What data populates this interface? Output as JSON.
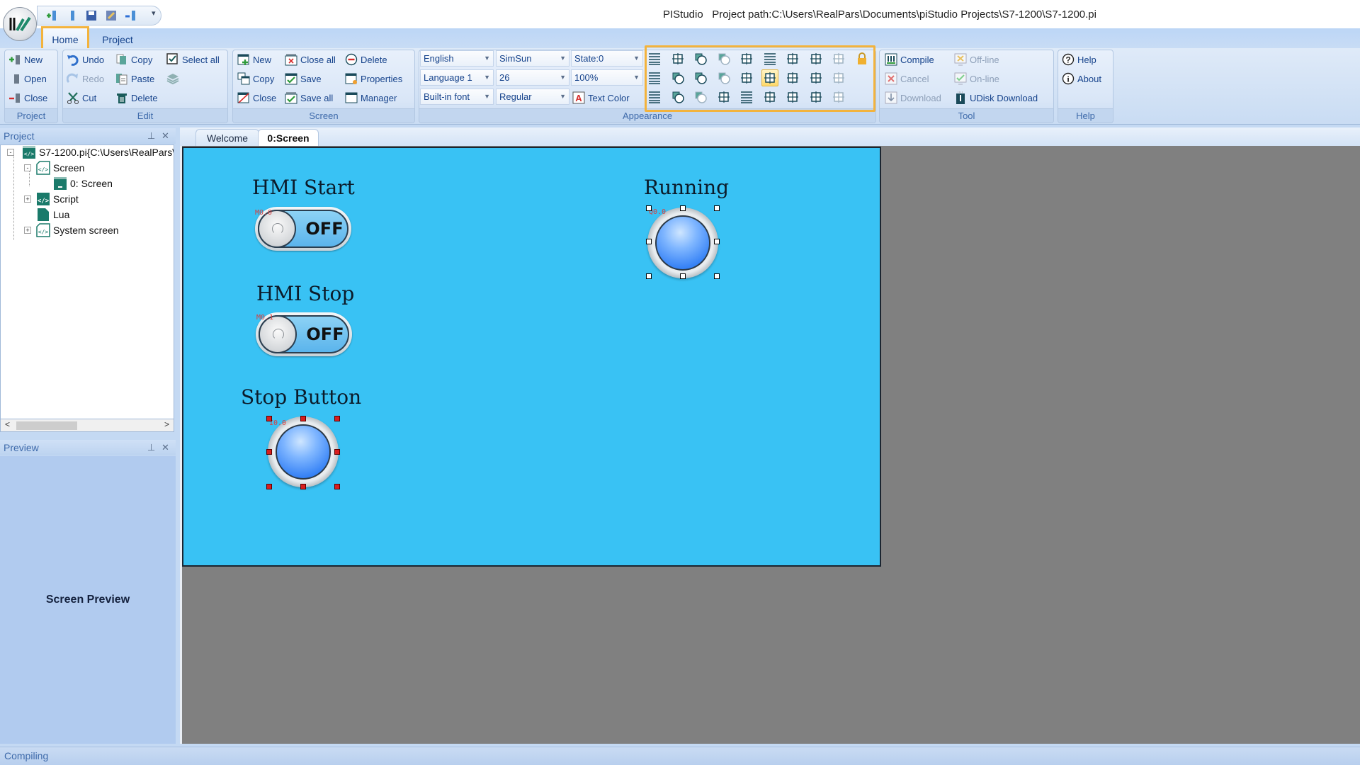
{
  "window": {
    "title": "PIStudio   Project path:C:\\Users\\RealPars\\Documents\\piStudio Projects\\S7-1200\\S7-1200.pi",
    "quick_access": [
      "new-project-icon",
      "open-icon",
      "save-icon",
      "edit-icon",
      "download-icon"
    ],
    "qat_dropdown": "▾"
  },
  "ribbon_tabs": [
    {
      "label": "Home",
      "active": true
    },
    {
      "label": "Project",
      "active": false
    }
  ],
  "ribbon": {
    "project": {
      "label": "Project",
      "buttons": [
        {
          "label": "New",
          "icon": "new-project-icon",
          "enabled": true
        },
        {
          "label": "Open",
          "icon": "open-icon",
          "enabled": true
        },
        {
          "label": "Close",
          "icon": "close-project-icon",
          "enabled": true
        }
      ]
    },
    "edit": {
      "label": "Edit",
      "buttons": [
        {
          "label": "Undo",
          "icon": "undo-icon",
          "enabled": true
        },
        {
          "label": "Redo",
          "icon": "redo-icon",
          "enabled": false
        },
        {
          "label": "Cut",
          "icon": "cut-icon",
          "enabled": true
        },
        {
          "label": "Copy",
          "icon": "copy-icon",
          "enabled": true
        },
        {
          "label": "Paste",
          "icon": "paste-icon",
          "enabled": true
        },
        {
          "label": "Delete",
          "icon": "delete-icon",
          "enabled": true
        },
        {
          "label": "Select all",
          "icon": "select-all-icon",
          "enabled": true
        },
        {
          "label": "",
          "icon": "layers-icon",
          "enabled": false
        }
      ]
    },
    "screen": {
      "label": "Screen",
      "buttons": [
        {
          "label": "New",
          "icon": "new-screen-icon",
          "enabled": true
        },
        {
          "label": "Copy",
          "icon": "copy-screen-icon",
          "enabled": true
        },
        {
          "label": "Close",
          "icon": "close-screen-icon",
          "enabled": true
        },
        {
          "label": "Close all",
          "icon": "close-all-icon",
          "enabled": true
        },
        {
          "label": "Save",
          "icon": "save-screen-icon",
          "enabled": true
        },
        {
          "label": "Save all",
          "icon": "save-all-icon",
          "enabled": true
        },
        {
          "label": "Delete",
          "icon": "delete-screen-icon",
          "enabled": true
        },
        {
          "label": "Properties",
          "icon": "properties-icon",
          "enabled": true
        },
        {
          "label": "Manager",
          "icon": "manager-icon",
          "enabled": true
        }
      ]
    },
    "appearance": {
      "label": "Appearance",
      "combos": {
        "language": "English",
        "language_index": "Language 1",
        "font_source": "Built-in font",
        "font_name": "SimSun",
        "font_size": "26",
        "font_style": "Regular",
        "state": "State:0",
        "zoom": "100%"
      },
      "text_color_label": "Text Color",
      "tools": [
        [
          "align-left-icon",
          "bring-forward-icon",
          "bring-to-front-icon",
          "rotate-left-icon",
          "align-bottom-icon",
          "align-left-edge-icon",
          "move-left-icon",
          "same-width-icon",
          "space-horizontal-icon",
          "lock-icon"
        ],
        [
          "align-center-icon",
          "send-backward-icon",
          "group-icon",
          "rotate-right-icon",
          "center-vertical-icon",
          "center-horizontal-icon",
          "move-down-icon",
          "same-height-icon",
          "space-vertical-icon"
        ],
        [
          "align-right-icon",
          "send-to-back-icon",
          "ungroup-icon",
          "align-top-icon",
          "align-right-edge-icon",
          "move-up-icon",
          "move-right-icon",
          "same-size-icon",
          "format-painter-icon"
        ]
      ],
      "active_tool": "center-horizontal-icon"
    },
    "tool": {
      "label": "Tool",
      "buttons": [
        {
          "label": "Compile",
          "icon": "compile-icon",
          "enabled": true
        },
        {
          "label": "Cancel",
          "icon": "cancel-icon",
          "enabled": false
        },
        {
          "label": "Download",
          "icon": "download-icon",
          "enabled": false
        },
        {
          "label": "Off-line",
          "icon": "offline-icon",
          "enabled": false
        },
        {
          "label": "On-line",
          "icon": "online-icon",
          "enabled": false
        },
        {
          "label": "UDisk Download",
          "icon": "udisk-download-icon",
          "enabled": true
        }
      ]
    },
    "help": {
      "label": "Help",
      "buttons": [
        {
          "label": "Help",
          "icon": "help-icon",
          "enabled": true
        },
        {
          "label": "About",
          "icon": "about-icon",
          "enabled": true
        }
      ]
    }
  },
  "project_panel": {
    "title": "Project",
    "tree": [
      {
        "label": "S7-1200.pi{C:\\Users\\RealPars\\",
        "level": 0,
        "expander": "-",
        "icon": "project-file-icon"
      },
      {
        "label": "Screen",
        "level": 1,
        "expander": "-",
        "icon": "screen-folder-icon"
      },
      {
        "label": "0: Screen",
        "level": 2,
        "expander": "",
        "icon": "screen-page-icon"
      },
      {
        "label": "Script",
        "level": 1,
        "expander": "+",
        "icon": "script-icon"
      },
      {
        "label": "Lua",
        "level": 1,
        "expander": "",
        "icon": "lua-icon"
      },
      {
        "label": "System screen",
        "level": 1,
        "expander": "+",
        "icon": "system-screen-icon"
      }
    ]
  },
  "preview_panel": {
    "title": "Preview",
    "content": "Screen Preview"
  },
  "doc_tabs": [
    {
      "label": "Welcome",
      "active": false
    },
    {
      "label": "0:Screen",
      "active": true
    }
  ],
  "canvas": {
    "background": "#39c2f4",
    "elements": [
      {
        "type": "label",
        "text": "HMI Start"
      },
      {
        "type": "toggle",
        "address": "M0.0",
        "state": "OFF"
      },
      {
        "type": "label",
        "text": "HMI Stop"
      },
      {
        "type": "toggle",
        "address": "M0.1",
        "state": "OFF"
      },
      {
        "type": "label",
        "text": "Stop Button"
      },
      {
        "type": "lamp",
        "address": "I0.0",
        "selected": true,
        "selection_color": "red"
      },
      {
        "type": "label",
        "text": "Running"
      },
      {
        "type": "lamp",
        "address": "Q0.0",
        "selected": true,
        "selection_color": "white"
      }
    ]
  },
  "status_bar": {
    "text": "Compiling"
  },
  "colors": {
    "highlight_border": "#f3b33d",
    "ribbon_text": "#15428b",
    "canvas_bg": "#39c2f4",
    "workspace_bg": "#808080"
  }
}
